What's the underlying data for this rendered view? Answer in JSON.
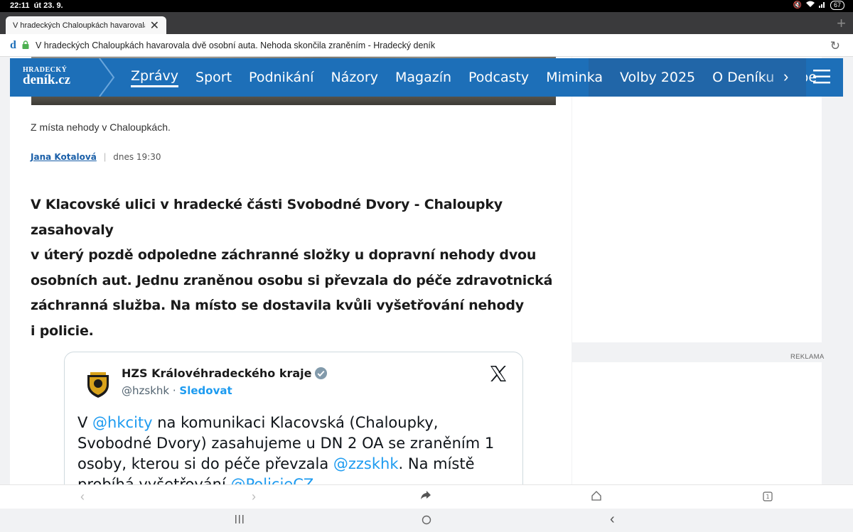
{
  "status_bar": {
    "time": "22:11",
    "date": "út 23. 9.",
    "battery": "67"
  },
  "tab": {
    "title": "V hradeckých Chaloupkách havarovala d...",
    "close": "✕",
    "new_tab": "+"
  },
  "address": {
    "logo": "d",
    "url": "V hradeckých Chaloupkách havarovala dvě osobní auta. Nehoda skončila zraněním - Hradecký deník"
  },
  "site": {
    "brand_top": "HRADECKÝ",
    "brand_main": "deník.cz",
    "nav": [
      "Zprávy",
      "Sport",
      "Podnikání",
      "Názory",
      "Magazín",
      "Podcasty",
      "Miminka",
      "Volby 2025",
      "O Deníku",
      "Spe"
    ],
    "active_index": 0,
    "more_arrow": "›"
  },
  "article": {
    "caption": "Z místa nehody v Chaloupkách.",
    "author": "Jana Kotalová",
    "separator": "|",
    "date": "dnes 19:30",
    "lead_lines": [
      "V Klacovské ulici v hradecké části Svobodné Dvory - Chaloupky zasahovaly",
      "v úterý pozdě odpoledne záchranné složky u dopravní nehody dvou",
      "osobních aut. Jednu zraněnou osobu si převzala do péče zdravotnická",
      "záchranná služba. Na místo se dostavila kvůli vyšetřování nehody",
      "i policie."
    ]
  },
  "tweet": {
    "name": "HZS Královéhradeckého kraje",
    "handle": "@hzskhk",
    "dot": "·",
    "follow": "Sledovat",
    "parts": [
      {
        "t": "V ",
        "m": false
      },
      {
        "t": "@hkcity",
        "m": true
      },
      {
        "t": " na komunikaci Klacovská (Chaloupky, Svobodné Dvory) zasahujeme u DN 2 OA se zraněním 1 osoby, kterou si do péče převzala ",
        "m": false
      },
      {
        "t": "@zzskhk",
        "m": true
      },
      {
        "t": ". Na místě probíhá vyšetřování ",
        "m": false
      },
      {
        "t": "@PolicieCZ",
        "m": true
      },
      {
        "t": ".",
        "m": false
      }
    ]
  },
  "ad_label": "REKLAMA",
  "colors": {
    "brand": "#1d6fb8",
    "mention": "#1d9bf0"
  }
}
